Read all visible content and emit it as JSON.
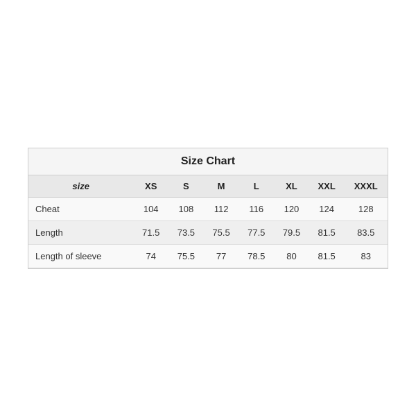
{
  "chart": {
    "title": "Size Chart",
    "headers": [
      "size",
      "XS",
      "S",
      "M",
      "L",
      "XL",
      "XXL",
      "XXXL"
    ],
    "rows": [
      {
        "label": "Cheat",
        "values": [
          "104",
          "108",
          "112",
          "116",
          "120",
          "124",
          "128"
        ]
      },
      {
        "label": "Length",
        "values": [
          "71.5",
          "73.5",
          "75.5",
          "77.5",
          "79.5",
          "81.5",
          "83.5"
        ]
      },
      {
        "label": "Length of sleeve",
        "values": [
          "74",
          "75.5",
          "77",
          "78.5",
          "80",
          "81.5",
          "83"
        ]
      }
    ]
  }
}
